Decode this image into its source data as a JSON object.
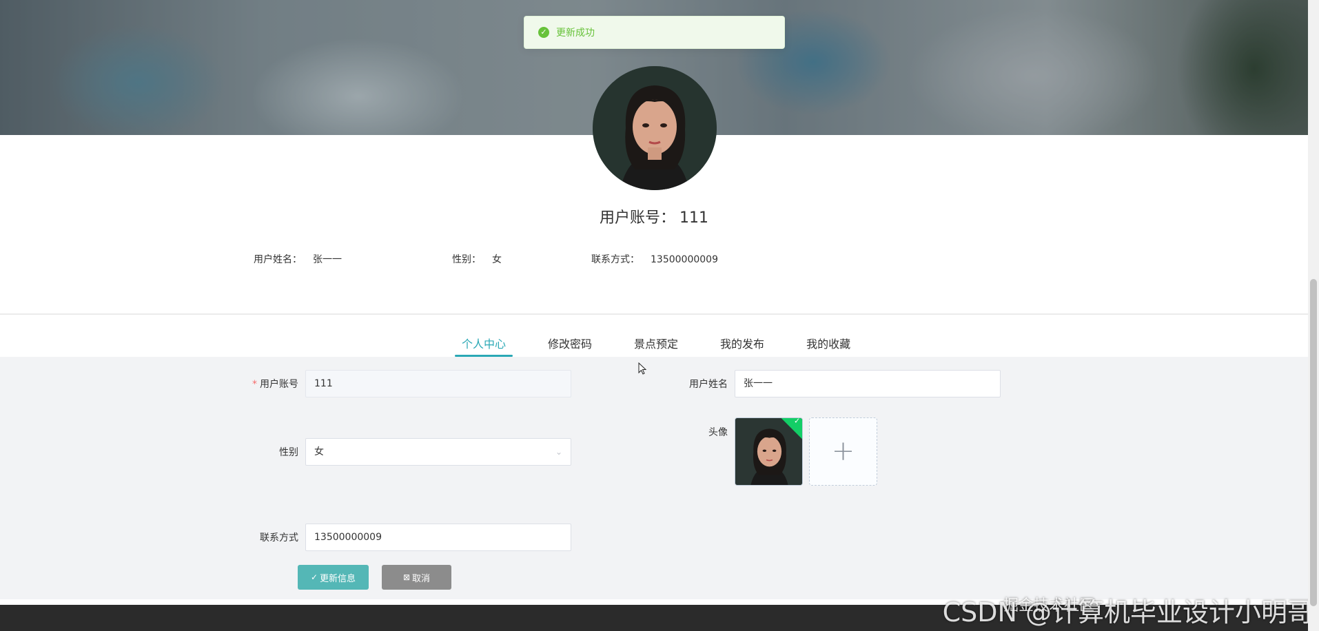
{
  "toast": {
    "text": "更新成功",
    "icon": "check-circle-icon"
  },
  "profile": {
    "account_label": "用户账号：",
    "account_value": "111",
    "name_label": "用户姓名：",
    "name_value": "张一一",
    "gender_label": "性别：",
    "gender_value": "女",
    "phone_label": "联系方式：",
    "phone_value": "13500000009"
  },
  "tabs": [
    {
      "label": "个人中心",
      "active": true
    },
    {
      "label": "修改密码",
      "active": false
    },
    {
      "label": "景点预定",
      "active": false
    },
    {
      "label": "我的发布",
      "active": false
    },
    {
      "label": "我的收藏",
      "active": false
    }
  ],
  "form": {
    "account_label": "用户账号",
    "account_value": "111",
    "name_label": "用户姓名",
    "name_value": "张一一",
    "gender_label": "性别",
    "gender_value": "女",
    "avatar_label": "头像",
    "phone_label": "联系方式",
    "phone_value": "13500000009",
    "submit_label": "更新信息",
    "cancel_label": "取消"
  },
  "watermark": {
    "main": "CSDN @计算机毕业设计小明哥",
    "sub": "掘金技术社区"
  },
  "colors": {
    "accent": "#2aa8b5",
    "primary_button": "#54b7b6",
    "cancel_button": "#8c8c8c",
    "success": "#67c23a"
  }
}
